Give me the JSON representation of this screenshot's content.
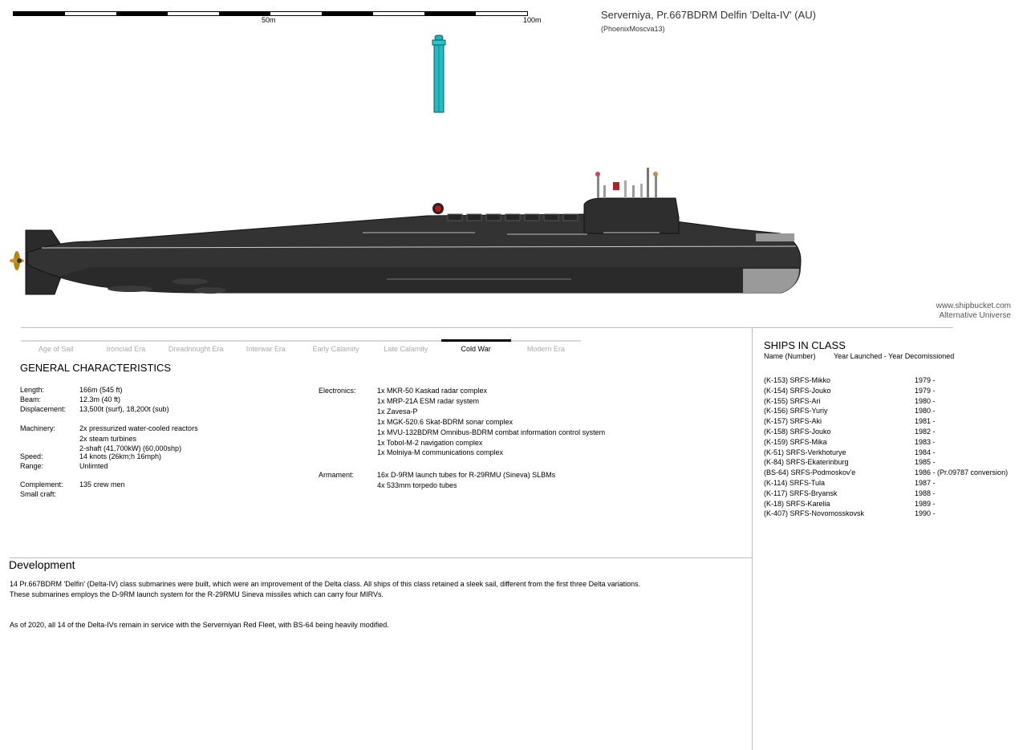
{
  "header": {
    "title": "Serverniya, Pr.667BDRM Delfin 'Delta-IV' (AU)",
    "author": "(PhoenixMoscva13)",
    "scale_labels": [
      "50m",
      "100m"
    ]
  },
  "credit": {
    "site": "www.shipbucket.com",
    "category": "Alternative Universe"
  },
  "eras": [
    "Age of Sail",
    "Ironclad Era",
    "Dreadnought Era",
    "Interwar Era",
    "Early Calamity",
    "Late Calamity",
    "Cold War",
    "Modern Era"
  ],
  "active_era": "Cold War",
  "general": {
    "title": "GENERAL CHARACTERISTICS",
    "length_label": "Length:",
    "length": "166m (545 ft)",
    "beam_label": "Beam:",
    "beam": "12.3m (40 ft)",
    "displacement_label": "Displacement:",
    "displacement": "13,500t (surf), 18,200t (sub)",
    "machinery_label": "Machinery:",
    "machinery": [
      "2x pressurized water-cooled reactors",
      "2x steam turbines",
      "2-shaft (41,700kW) (60,000shp)"
    ],
    "speed_label": "Speed:",
    "speed": "14 knots (26km;h 16mph)",
    "range_label": "Range:",
    "range": "Unlimted",
    "complement_label": "Complement:",
    "complement": "135 crew men",
    "small_craft_label": "Small craft:",
    "electronics_label": "Electronics:",
    "electronics": [
      "1x MKR-50 Kaskad radar complex",
      "1x MRP-21A ESM radar system",
      "1x Zavesa-P",
      "1x MGK-520.6 Skat-BDRM sonar complex",
      "1x MVU-132BDRM Omnibus-BDRM combat information control system",
      "1x Tobol-M-2 navigation complex",
      "1x Molniya-M communications complex"
    ],
    "armament_label": "Armament:",
    "armament": [
      "16x D-9RM launch tubes for R-29RMU (Sineva) SLBMs",
      "4x 533mm torpedo tubes"
    ]
  },
  "development": {
    "title": "Development",
    "p1_line1": "14 Pr.667BDRM 'Delfin' (Delta-IV) class submarines were built, which were an improvement of the Delta class. All ships of this class retained a sleek sail, different from the first three Delta variations.",
    "p1_line2": "These submarines employs the D-9RM launch system for the R-29RMU Sineva missiles which can carry four MIRVs.",
    "p2": "As of 2020, all 14 of the Delta-IVs remain in service with the Serverniyan Red Fleet, with BS-64 being heavily modified."
  },
  "ships": {
    "title": "SHIPS IN CLASS",
    "header_name": "Name (Number)",
    "header_years": "Year Launched - Year Decomissioned",
    "list": [
      {
        "name": "(K-153) SRFS-Mikko",
        "years": "1979 -"
      },
      {
        "name": "(K-154) SRFS-Jouko",
        "years": "1979 -"
      },
      {
        "name": "(K-155) SRFS-Ari",
        "years": "1980 -"
      },
      {
        "name": "(K-156) SRFS-Yuriy",
        "years": "1980 -"
      },
      {
        "name": "(K-157) SRFS-Aki",
        "years": "1981 -"
      },
      {
        "name": "(K-158) SRFS-Jouko",
        "years": "1982 -"
      },
      {
        "name": "(K-159) SRFS-Mika",
        "years": "1983 -"
      },
      {
        "name": "(K-51) SRFS-Verkhoturye",
        "years": "1984 -"
      },
      {
        "name": "(K-84) SRFS-Ekaterinburg",
        "years": "1985 -"
      },
      {
        "name": "(BS-64) SRFS-Podmoskov'e",
        "years": "1986 - (Pr.09787 conversion)"
      },
      {
        "name": "(K-114) SRFS-Tula",
        "years": "1987 -"
      },
      {
        "name": "(K-117) SRFS-Bryansk",
        "years": "1988 -"
      },
      {
        "name": "(K-18) SRFS-Karelia",
        "years": "1989 -"
      },
      {
        "name": "(K-407) SRFS-Novomosskovsk",
        "years": "1990 -"
      }
    ]
  }
}
